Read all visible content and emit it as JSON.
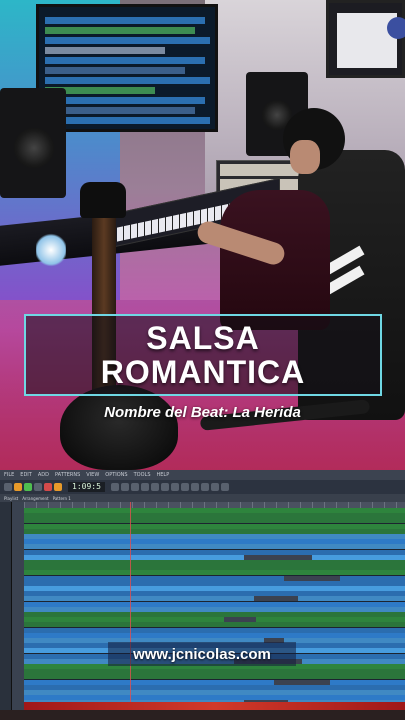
{
  "title": {
    "line1": "SALSA",
    "line2": "ROMANTICA"
  },
  "beat_name": "Nombre del Beat: La Herida",
  "daw": {
    "menu": [
      "FILE",
      "EDIT",
      "ADD",
      "PATTERNS",
      "VIEW",
      "OPTIONS",
      "TOOLS",
      "HELP"
    ],
    "time_display": "1:09:5",
    "subbar": [
      "Playlist",
      "Arrangement",
      "Pattern 1"
    ],
    "colors": {
      "track_blue": "#2f7fd0",
      "track_light": "#4aa3e8",
      "track_green": "#2f8a3e",
      "track_red": "#c02a20",
      "playhead": "#e05050"
    }
  },
  "url": "www.jcnicolas.com"
}
